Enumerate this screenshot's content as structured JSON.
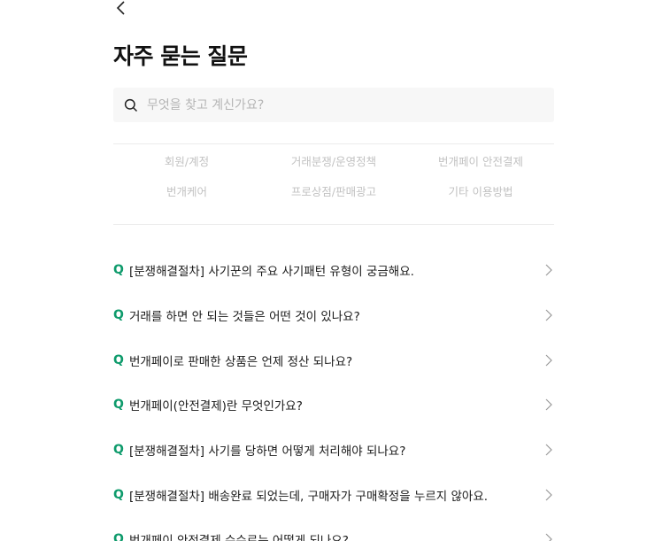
{
  "page": {
    "title": "자주 묻는 질문"
  },
  "search": {
    "placeholder": "무엇을 찾고 계신가요?"
  },
  "categories": [
    {
      "label": "회원/계정"
    },
    {
      "label": "거래분쟁/운영정책"
    },
    {
      "label": "번개페이 안전결제"
    },
    {
      "label": "번개케어"
    },
    {
      "label": "프로상점/판매광고"
    },
    {
      "label": "기타 이용방법"
    }
  ],
  "faq": {
    "prefix": "Q",
    "items": [
      {
        "question": "[분쟁해결절차] 사기꾼의 주요 사기패턴 유형이 궁금해요."
      },
      {
        "question": "거래를 하면 안 되는 것들은 어떤 것이 있나요?"
      },
      {
        "question": "번개페이로 판매한 상품은 언제 정산 되나요?"
      },
      {
        "question": "번개페이(안전결제)란 무엇인가요?"
      },
      {
        "question": "[분쟁해결절차] 사기를 당하면 어떻게 처리해야 되나요?"
      },
      {
        "question": "[분쟁해결절차] 배송완료 되었는데, 구매자가 구매확정을 누르지 않아요."
      },
      {
        "question": "번개페이 안전결제 수수료는 어떻게 되나요?"
      }
    ]
  },
  "colors": {
    "accent": "#0f9b6c",
    "search_bg": "#f7f7f7",
    "category_text": "#c2c2c2"
  },
  "icons": {
    "back": "chevron-left-icon",
    "search": "search-icon",
    "item_arrow": "chevron-right-icon"
  }
}
